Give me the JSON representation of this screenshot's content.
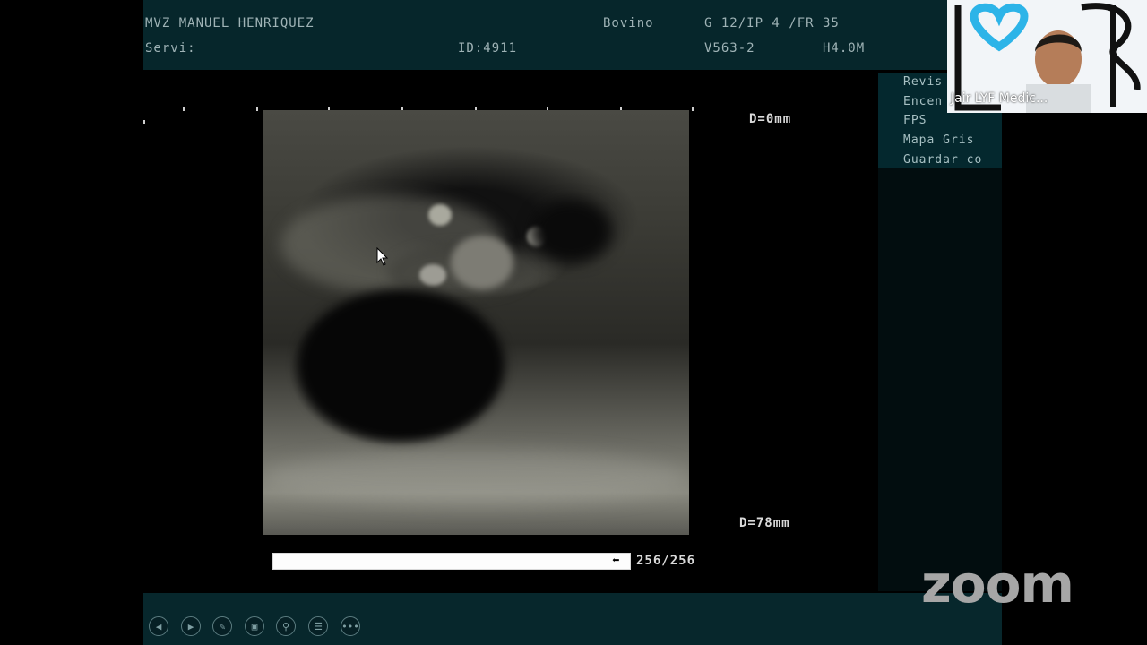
{
  "header": {
    "operator": "MVZ MANUEL HENRIQUEZ",
    "species": "Bovino",
    "params": "G 12/IP 4 /FR 35",
    "service": "Servi:",
    "id": "ID:4911",
    "probe": "V563-2",
    "frequency": "H4.0M"
  },
  "scan": {
    "depth_top": "D=0mm",
    "depth_bottom": "D=78mm"
  },
  "menu": {
    "items": [
      "Revis",
      "Encen",
      "FPS",
      "Mapa Gris",
      "Guardar co"
    ]
  },
  "playback": {
    "progress": 1.0,
    "counter": "256/256"
  },
  "toolbar": {
    "icons": [
      "prev-icon",
      "next-icon",
      "pen-icon",
      "copy-icon",
      "zoom-icon",
      "menu-icon",
      "more-icon"
    ]
  },
  "video": {
    "speaker": "Jair LYF Medic..."
  },
  "branding": {
    "logo": "zoom"
  },
  "colors": {
    "panel_bg": "#06262b",
    "text": "#9fb3b6",
    "logo_blue": "#2db4e8"
  }
}
